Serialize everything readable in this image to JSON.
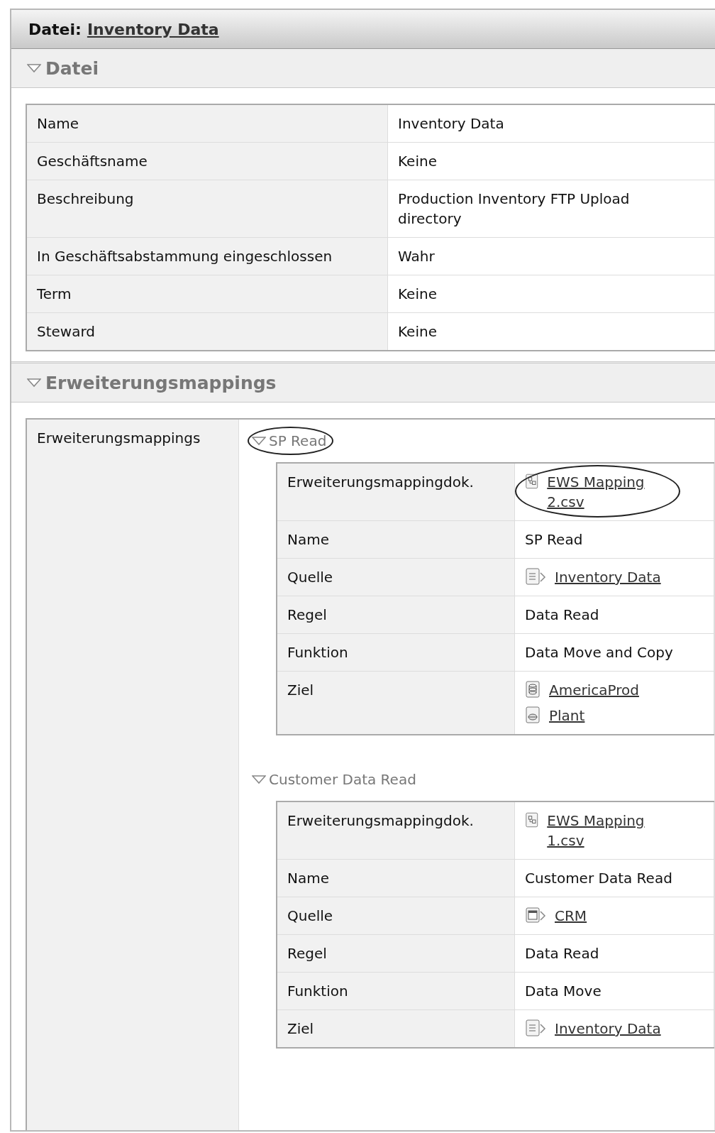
{
  "title": {
    "prefix": "Datei:",
    "link": "Inventory Data"
  },
  "sections": [
    {
      "kind": "properties",
      "heading": "Datei",
      "expanded": true,
      "rows": [
        {
          "kind": "text",
          "label": "Name",
          "value": "Inventory Data"
        },
        {
          "kind": "text",
          "label": "Geschäftsname",
          "value": "Keine"
        },
        {
          "kind": "text",
          "label": "Beschreibung",
          "value": "Production Inventory FTP Upload directory"
        },
        {
          "kind": "text",
          "label": "In Geschäftsabstammung eingeschlossen",
          "value": "Wahr"
        },
        {
          "kind": "text",
          "label": "Term",
          "value": "Keine"
        },
        {
          "kind": "text",
          "label": "Steward",
          "value": "Keine"
        }
      ]
    },
    {
      "kind": "mappings",
      "heading": "Erweiterungsmappings",
      "expanded": true,
      "label": "Erweiterungsmappings",
      "groups": [
        {
          "title": "SP Read",
          "expanded": true,
          "circled": true,
          "rows": [
            {
              "kind": "links",
              "label": "Erweiterungsmappingdok.",
              "links": [
                {
                  "kind": "mapping",
                  "text": "EWS Mapping 2.csv",
                  "circled": true
                }
              ]
            },
            {
              "kind": "text",
              "label": "Name",
              "value": "SP Read"
            },
            {
              "kind": "links",
              "label": "Quelle",
              "links": [
                {
                  "kind": "file",
                  "text": "Inventory Data",
                  "circled": false
                }
              ]
            },
            {
              "kind": "text",
              "label": "Regel",
              "value": "Data Read"
            },
            {
              "kind": "text",
              "label": "Funktion",
              "value": "Data Move and Copy"
            },
            {
              "kind": "links",
              "label": "Ziel",
              "links": [
                {
                  "kind": "database",
                  "text": "AmericaProd",
                  "circled": false
                },
                {
                  "kind": "schema",
                  "text": "Plant",
                  "circled": false
                }
              ]
            }
          ]
        },
        {
          "title": "Customer Data Read",
          "expanded": true,
          "circled": false,
          "rows": [
            {
              "kind": "links",
              "label": "Erweiterungsmappingdok.",
              "links": [
                {
                  "kind": "mapping",
                  "text": "EWS Mapping 1.csv",
                  "circled": false
                }
              ]
            },
            {
              "kind": "text",
              "label": "Name",
              "value": "Customer Data Read"
            },
            {
              "kind": "links",
              "label": "Quelle",
              "links": [
                {
                  "kind": "table",
                  "text": "CRM",
                  "circled": false
                }
              ]
            },
            {
              "kind": "text",
              "label": "Regel",
              "value": "Data Read"
            },
            {
              "kind": "text",
              "label": "Funktion",
              "value": "Data Move"
            },
            {
              "kind": "links",
              "label": "Ziel",
              "links": [
                {
                  "kind": "file",
                  "text": "Inventory Data",
                  "circled": false
                }
              ]
            }
          ]
        }
      ]
    }
  ]
}
